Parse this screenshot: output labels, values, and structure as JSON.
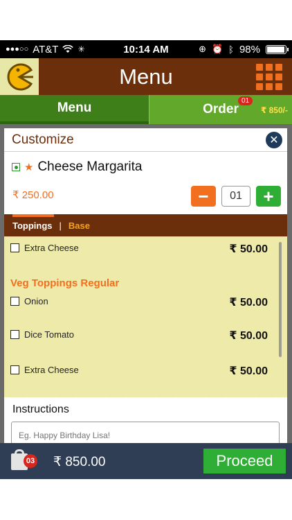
{
  "status_bar": {
    "carrier": "AT&T",
    "time": "10:14 AM",
    "battery": "98%",
    "battery_level": 0.98
  },
  "header": {
    "title": "Menu"
  },
  "tabs": [
    {
      "label": "Menu"
    },
    {
      "label": "Order",
      "badge": "01"
    }
  ],
  "order_total": "₹ 850/-",
  "customize": {
    "title": "Customize",
    "item_name": "Cheese Margarita",
    "price": "₹ 250.00",
    "quantity": "01"
  },
  "subtabs": {
    "active": "Toppings",
    "separator": "|",
    "other": "Base"
  },
  "toppings": {
    "first_item": {
      "label": "Extra Cheese",
      "price": "₹ 50.00"
    },
    "section_title": "Veg Toppings Regular",
    "items": [
      {
        "label": "Onion",
        "price": "₹ 50.00"
      },
      {
        "label": "Dice Tomato",
        "price": "₹ 50.00"
      },
      {
        "label": "Extra Cheese",
        "price": "₹ 50.00"
      }
    ]
  },
  "instructions": {
    "label": "Instructions",
    "placeholder": "Eg. Happy Birthday Lisa!"
  },
  "bottom_bar": {
    "cart_count": "03",
    "total": "₹ 850.00",
    "proceed_label": "Proceed"
  },
  "colors": {
    "brown": "#6b2f0c",
    "orange": "#f36f20",
    "green": "#2fae36",
    "navy": "#2f3d55",
    "cream": "#eeeaaa"
  }
}
